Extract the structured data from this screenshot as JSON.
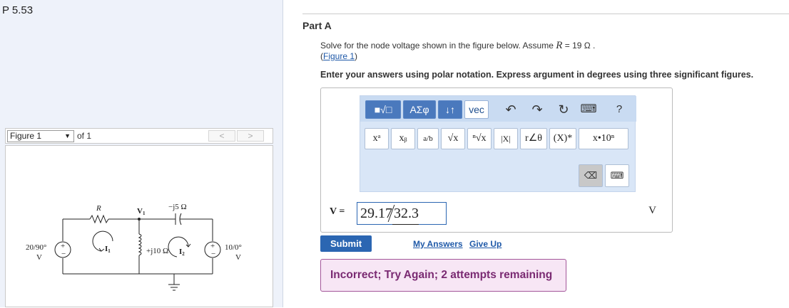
{
  "problem": {
    "id": "P 5.53"
  },
  "figure_panel": {
    "select_value": "Figure 1",
    "of_text": "of 1",
    "prev_label": "<",
    "next_label": ">",
    "circuit": {
      "labels": {
        "R": "R",
        "v1": "V",
        "v1_sub": "1",
        "cap": "−j5 Ω",
        "ind": "+j10 Ω",
        "i1": "I",
        "i1_sub": "1",
        "i2": "I",
        "i2_sub": "2",
        "src_left_top": "20/90°",
        "src_left_bottom": "V",
        "src_right_top": "10/0°",
        "src_right_bottom": "V"
      }
    }
  },
  "part": {
    "title": "Part A",
    "text_before": "Solve for the node voltage shown in the figure below. Assume ",
    "var": "R",
    "text_after": " = 19 Ω .",
    "figure_link": "Figure 1",
    "instructions": "Enter your answers using polar notation. Express argument in degrees using three significant figures."
  },
  "toolbar": {
    "templates_btn": "■√□",
    "greek_btn": "ΑΣφ",
    "arrows_btn": "↓↑",
    "vec_btn": "vec",
    "undo_icon": "↶",
    "redo_icon": "↷",
    "reset_icon": "↻",
    "keyboard_icon": "⌨",
    "help_icon": "?",
    "buttons": [
      {
        "label": "xᵃ"
      },
      {
        "label": "xᵦ"
      },
      {
        "label": "a/b"
      },
      {
        "label": "√x"
      },
      {
        "label": "ⁿ√x"
      },
      {
        "label": "|X|"
      },
      {
        "label": "r∠θ"
      },
      {
        "label": "(X)*"
      },
      {
        "label": "x•10ⁿ"
      }
    ],
    "delete_icon": "⌫",
    "keyboard_toggle_icon": "⌨"
  },
  "answer": {
    "var_label": "V =",
    "magnitude": "29.17",
    "angle": "32.3",
    "units": "V"
  },
  "actions": {
    "submit": "Submit",
    "my_answers": "My Answers",
    "give_up": "Give Up"
  },
  "feedback": "Incorrect; Try Again; 2 attempts remaining"
}
